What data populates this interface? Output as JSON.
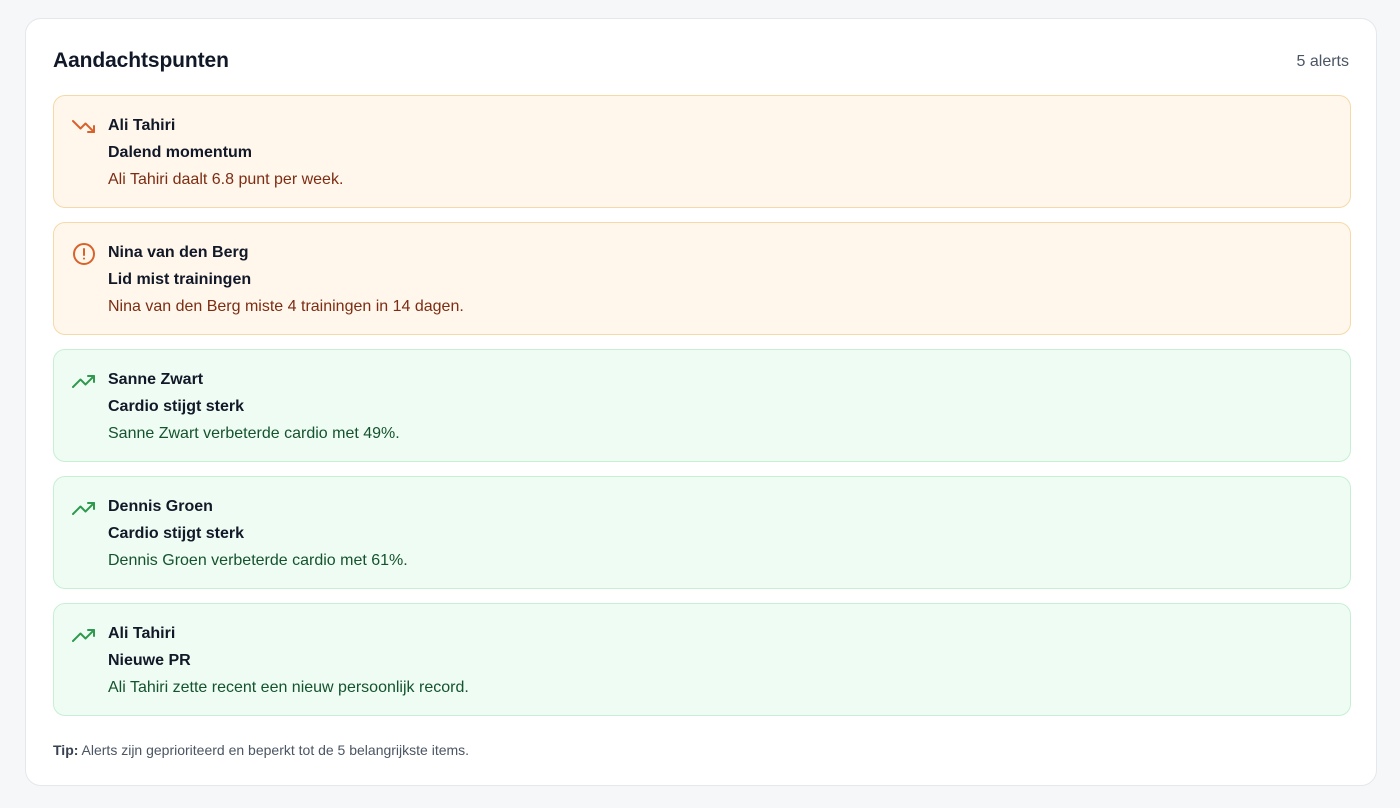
{
  "panel": {
    "title": "Aandachtspunten",
    "count_label": "5 alerts"
  },
  "alerts": [
    {
      "member": "Ali Tahiri",
      "title": "Dalend momentum",
      "message": "Ali Tahiri daalt 6.8 punt per week.",
      "severity": "warning",
      "icon": "trending-down-icon"
    },
    {
      "member": "Nina van den Berg",
      "title": "Lid mist trainingen",
      "message": "Nina van den Berg miste 4 trainingen in 14 dagen.",
      "severity": "warning",
      "icon": "alert-circle-icon"
    },
    {
      "member": "Sanne Zwart",
      "title": "Cardio stijgt sterk",
      "message": "Sanne Zwart verbeterde cardio met 49%.",
      "severity": "success",
      "icon": "trending-up-icon"
    },
    {
      "member": "Dennis Groen",
      "title": "Cardio stijgt sterk",
      "message": "Dennis Groen verbeterde cardio met 61%.",
      "severity": "success",
      "icon": "trending-up-icon"
    },
    {
      "member": "Ali Tahiri",
      "title": "Nieuwe PR",
      "message": "Ali Tahiri zette recent een nieuw persoonlijk record.",
      "severity": "success",
      "icon": "trending-up-icon"
    }
  ],
  "tip": {
    "label": "Tip:",
    "text": "Alerts zijn geprioriteerd en beperkt tot de 5 belangrijkste items."
  },
  "colors": {
    "warning_icon": "#d9622b",
    "success_icon": "#2f9a4e",
    "warning_bg": "#fff6ec",
    "success_bg": "#effcf3"
  }
}
